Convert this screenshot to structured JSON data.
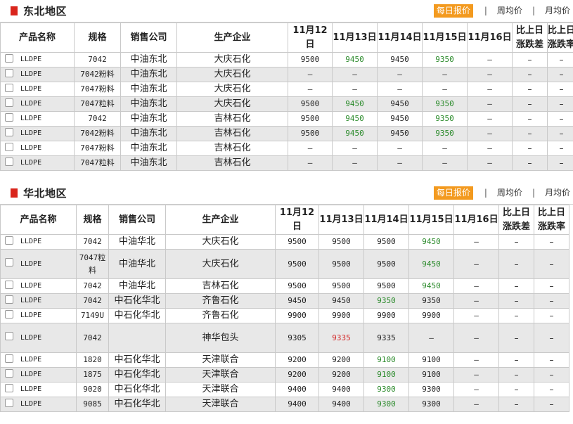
{
  "sections": [
    {
      "title": "东北地区",
      "tabs": [
        "每日报价",
        "周均价",
        "月均价"
      ],
      "active_tab": 0,
      "headers": [
        "产品名称",
        "规格",
        "销售公司",
        "生产企业",
        "11月12日",
        "11月13日",
        "11月14日",
        "11月15日",
        "11月16日",
        "比上日\n涨跌差",
        "比上日\n涨跌率"
      ],
      "rows": [
        {
          "product": "LLDPE",
          "spec": "7042",
          "seller": "中油东北",
          "producer": "大庆石化",
          "prices": [
            "9500",
            "9450",
            "9450",
            "9350",
            "–"
          ],
          "diff": "–",
          "rate": "–"
        },
        {
          "product": "LLDPE",
          "spec": "7042粉料",
          "seller": "中油东北",
          "producer": "大庆石化",
          "prices": [
            "–",
            "–",
            "–",
            "–",
            "–"
          ],
          "diff": "–",
          "rate": "–"
        },
        {
          "product": "LLDPE",
          "spec": "7047粉料",
          "seller": "中油东北",
          "producer": "大庆石化",
          "prices": [
            "–",
            "–",
            "–",
            "–",
            "–"
          ],
          "diff": "–",
          "rate": "–"
        },
        {
          "product": "LLDPE",
          "spec": "7047粒料",
          "seller": "中油东北",
          "producer": "大庆石化",
          "prices": [
            "9500",
            "9450",
            "9450",
            "9350",
            "–"
          ],
          "diff": "–",
          "rate": "–"
        },
        {
          "product": "LLDPE",
          "spec": "7042",
          "seller": "中油东北",
          "producer": "吉林石化",
          "prices": [
            "9500",
            "9450",
            "9450",
            "9350",
            "–"
          ],
          "diff": "–",
          "rate": "–"
        },
        {
          "product": "LLDPE",
          "spec": "7042粉料",
          "seller": "中油东北",
          "producer": "吉林石化",
          "prices": [
            "9500",
            "9450",
            "9450",
            "9350",
            "–"
          ],
          "diff": "–",
          "rate": "–"
        },
        {
          "product": "LLDPE",
          "spec": "7047粉料",
          "seller": "中油东北",
          "producer": "吉林石化",
          "prices": [
            "–",
            "–",
            "–",
            "–",
            "–"
          ],
          "diff": "–",
          "rate": "–"
        },
        {
          "product": "LLDPE",
          "spec": "7047粒料",
          "seller": "中油东北",
          "producer": "吉林石化",
          "prices": [
            "–",
            "–",
            "–",
            "–",
            "–"
          ],
          "diff": "–",
          "rate": "–"
        }
      ]
    },
    {
      "title": "华北地区",
      "tabs": [
        "每日报价",
        "周均价",
        "月均价"
      ],
      "active_tab": 0,
      "headers": [
        "产品名称",
        "规格",
        "销售公司",
        "生产企业",
        "11月12日",
        "11月13日",
        "11月14日",
        "11月15日",
        "11月16日",
        "比上日\n涨跌差",
        "比上日\n涨跌率"
      ],
      "rows": [
        {
          "product": "LLDPE",
          "spec": "7042",
          "seller": "中油华北",
          "producer": "大庆石化",
          "prices": [
            "9500",
            "9500",
            "9500",
            "9450",
            "–"
          ],
          "diff": "–",
          "rate": "–"
        },
        {
          "product": "LLDPE",
          "spec": "7047粒料",
          "seller": "中油华北",
          "producer": "大庆石化",
          "prices": [
            "9500",
            "9500",
            "9500",
            "9450",
            "–"
          ],
          "diff": "–",
          "rate": "–"
        },
        {
          "product": "LLDPE",
          "spec": "7042",
          "seller": "中油华北",
          "producer": "吉林石化",
          "prices": [
            "9500",
            "9500",
            "9500",
            "9450",
            "–"
          ],
          "diff": "–",
          "rate": "–"
        },
        {
          "product": "LLDPE",
          "spec": "7042",
          "seller": "中石化华北",
          "producer": "齐鲁石化",
          "prices": [
            "9450",
            "9450",
            "9350",
            "9350",
            "–"
          ],
          "diff": "–",
          "rate": "–"
        },
        {
          "product": "LLDPE",
          "spec": "7149U",
          "seller": "中石化华北",
          "producer": "齐鲁石化",
          "prices": [
            "9900",
            "9900",
            "9900",
            "9900",
            "–"
          ],
          "diff": "–",
          "rate": "–"
        },
        {
          "product": "LLDPE",
          "spec": "7042",
          "seller": "",
          "producer": "神华包头",
          "prices": [
            "9305",
            "9335",
            "9335",
            "–",
            "–"
          ],
          "diff": "–",
          "rate": "–"
        },
        {
          "product": "LLDPE",
          "spec": "1820",
          "seller": "中石化华北",
          "producer": "天津联合",
          "prices": [
            "9200",
            "9200",
            "9100",
            "9100",
            "–"
          ],
          "diff": "–",
          "rate": "–"
        },
        {
          "product": "LLDPE",
          "spec": "1875",
          "seller": "中石化华北",
          "producer": "天津联合",
          "prices": [
            "9200",
            "9200",
            "9100",
            "9100",
            "–"
          ],
          "diff": "–",
          "rate": "–"
        },
        {
          "product": "LLDPE",
          "spec": "9020",
          "seller": "中石化华北",
          "producer": "天津联合",
          "prices": [
            "9400",
            "9400",
            "9300",
            "9300",
            "–"
          ],
          "diff": "–",
          "rate": "–"
        },
        {
          "product": "LLDPE",
          "spec": "9085",
          "seller": "中石化华北",
          "producer": "天津联合",
          "prices": [
            "9400",
            "9400",
            "9300",
            "9300",
            "–"
          ],
          "diff": "–",
          "rate": "–"
        }
      ]
    }
  ],
  "colors": {
    "up": "#d42a2a",
    "down": "#2a8a2a",
    "neutral": "#222222",
    "active_tab": "#f39a1f",
    "marker": "#d9251c",
    "alt_row": "#e8e8e8"
  }
}
